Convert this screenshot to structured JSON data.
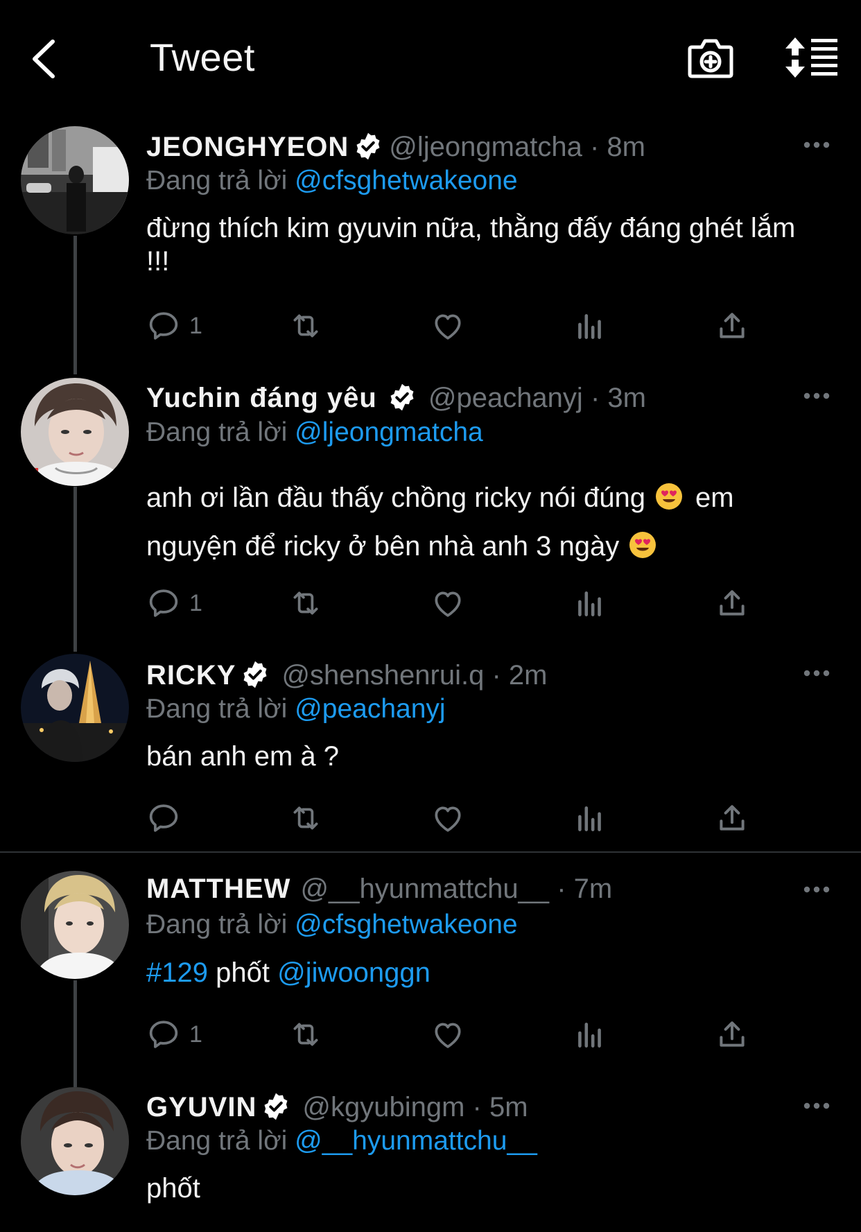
{
  "header": {
    "title": "Tweet",
    "icons": [
      "back-arrow-icon",
      "camera-plus-icon",
      "sort-icon"
    ]
  },
  "colors": {
    "background": "#000000",
    "link": "#1d9bf0",
    "muted": "#71767b",
    "verified": "#ffffff"
  },
  "tweets": [
    {
      "name": "JEONGHYEON",
      "handle": "@ljeongmatcha",
      "time": "· 8m",
      "reply_prefix": "Đang trả lời",
      "reply_to": "@cfsghetwakeone",
      "text": "đừng thích kim gyuvin nữa, thằng đấy đáng ghét lắm !!!",
      "reply_count": "1"
    },
    {
      "name": "Yuchin đáng yêu",
      "handle": "@peachanyj",
      "time": "· 3m",
      "reply_prefix": "Đang trả lời",
      "reply_to": "@ljeongmatcha",
      "text_1": "anh ơi lần đầu thấy chồng ricky nói đúng",
      "text_2": "em nguyện để ricky ở bên nhà anh 3 ngày",
      "emoji": "heart-eyes-emoji",
      "reply_count": "1"
    },
    {
      "name": "RICKY",
      "handle": "@shenshenrui.q",
      "time": "· 2m",
      "reply_prefix": "Đang trả lời",
      "reply_to": "@peachanyj",
      "text": "bán anh em à ?",
      "reply_count": ""
    },
    {
      "name": "MATTHEW",
      "handle": "@__hyunmattchu__",
      "time": "· 7m",
      "reply_prefix": "Đang trả lời",
      "reply_to": "@cfsghetwakeone",
      "hashtag": "#129",
      "text_mid": "phốt",
      "mention": "@jiwoonggn",
      "reply_count": "1"
    },
    {
      "name": "GYUVIN",
      "handle": "@kgyubingm",
      "time": "· 5m",
      "reply_prefix": "Đang trả lời",
      "reply_to": "@__hyunmattchu__",
      "text": "phốt"
    }
  ]
}
